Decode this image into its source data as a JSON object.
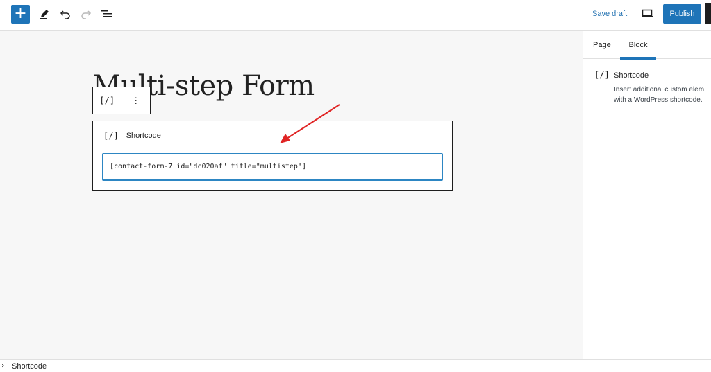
{
  "toolbar": {
    "add_block_label": "+",
    "tools_icon": "pencil-icon",
    "undo_icon": "undo-icon",
    "redo_icon": "redo-icon",
    "list_view_icon": "list-view-icon",
    "save_draft_label": "Save draft",
    "preview_icon": "desktop-preview-icon",
    "publish_label": "Publish",
    "accent_color": "#1e74b8"
  },
  "editor": {
    "page_title": "Multi-step Form",
    "block_toolbar": {
      "shortcode_icon_label": "[/]",
      "options_label": "⋮"
    },
    "shortcode_block": {
      "icon_label": "[/]",
      "label": "Shortcode",
      "input_value": "[contact-form-7 id=\"dc020af\" title=\"multistep\"]"
    },
    "annotation_arrow_color": "#e02424"
  },
  "sidebar": {
    "tabs": [
      {
        "label": "Page"
      },
      {
        "label": "Block",
        "active": true
      }
    ],
    "block_card": {
      "icon_label": "[/]",
      "title": "Shortcode",
      "description_line1": "Insert additional custom elem",
      "description_line2": "with a WordPress shortcode."
    }
  },
  "footer": {
    "breadcrumb_chevron": "›",
    "breadcrumb": "Shortcode"
  }
}
